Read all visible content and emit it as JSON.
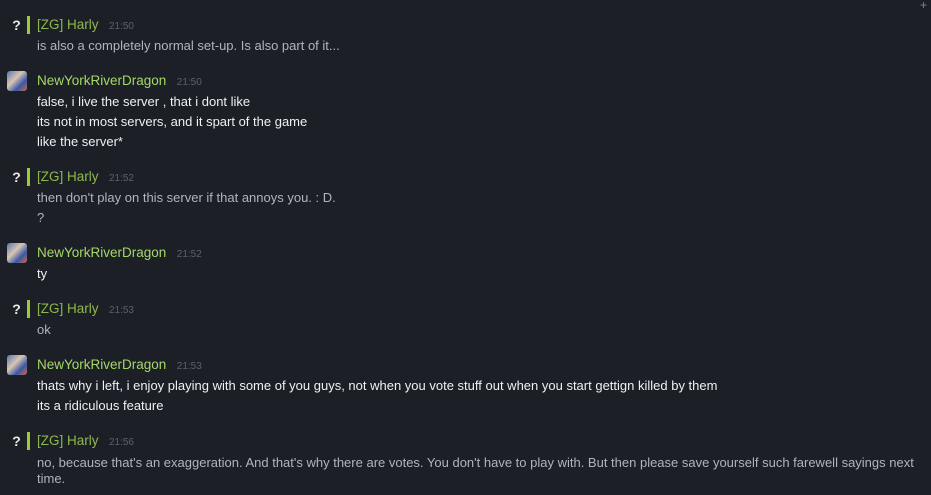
{
  "messages": [
    {
      "author": "[ZG] Harly",
      "time": "21:50",
      "avatar": "unknown",
      "lines": [
        "is also a completely normal set-up. Is also part of it..."
      ]
    },
    {
      "author": "NewYorkRiverDragon",
      "time": "21:50",
      "avatar": "image",
      "lines": [
        "false, i live the server , that i dont like",
        "its not in most servers, and it spart of the game",
        "like the server*"
      ]
    },
    {
      "author": "[ZG] Harly",
      "time": "21:52",
      "avatar": "unknown",
      "lines": [
        "then don't play on this server if that annoys you. : D.",
        "?"
      ]
    },
    {
      "author": "NewYorkRiverDragon",
      "time": "21:52",
      "avatar": "image",
      "lines": [
        "ty"
      ]
    },
    {
      "author": "[ZG] Harly",
      "time": "21:53",
      "avatar": "unknown",
      "lines": [
        "ok"
      ]
    },
    {
      "author": "NewYorkRiverDragon",
      "time": "21:53",
      "avatar": "image",
      "lines": [
        "thats why i left, i enjoy playing with some of you guys, not when you vote stuff out when you start gettign killed by them",
        "its a ridiculous feature"
      ]
    },
    {
      "author": "[ZG] Harly",
      "time": "21:56",
      "avatar": "unknown",
      "lines": [
        "no, because that's an exaggeration. And that's why there are votes. You don't have to play with. But then please save yourself such farewell sayings next time."
      ]
    }
  ],
  "unknown_avatar_glyph": "?",
  "corner_icon": "+"
}
